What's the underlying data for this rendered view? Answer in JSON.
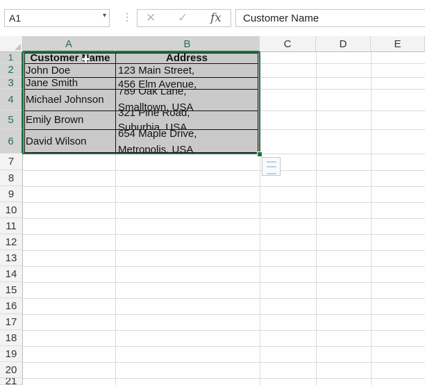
{
  "namebox": {
    "value": "A1",
    "arrow": "▾"
  },
  "formula_buttons": {
    "cancel": "✕",
    "enter": "✓",
    "fx": "fx"
  },
  "formula_bar": {
    "value": "Customer Name"
  },
  "columns": [
    "A",
    "B",
    "C",
    "D",
    "E"
  ],
  "rows": [
    "1",
    "2",
    "3",
    "4",
    "5",
    "6",
    "7",
    "8",
    "9",
    "10",
    "11",
    "12",
    "13",
    "14",
    "15",
    "16",
    "17",
    "18",
    "19",
    "20",
    "21"
  ],
  "table": {
    "header": {
      "a": "Customer Name",
      "b": "Address"
    },
    "r2": {
      "a": "John Doe",
      "b": "123 Main Street,"
    },
    "r3": {
      "a": "Jane Smith",
      "b": "456 Elm Avenue,"
    },
    "r4": {
      "a": "Michael Johnson",
      "b1": "789 Oak Lane,",
      "b2": "Smalltown, USA"
    },
    "r5": {
      "a": "Emily Brown",
      "b1": "321 Pine Road,",
      "b2": "Suburbia, USA"
    },
    "r6": {
      "a": "David Wilson",
      "b1": "654 Maple Drive,",
      "b2": "Metropolis, USA"
    }
  },
  "icons": {
    "corner": "select-all-triangle",
    "quick_analysis": "quick-analysis-icon",
    "cursor": "cell-select-cursor-icon"
  },
  "colors": {
    "accent": "#217346",
    "selection": "#c9c9c9",
    "header_bg": "#f3f3f3"
  }
}
